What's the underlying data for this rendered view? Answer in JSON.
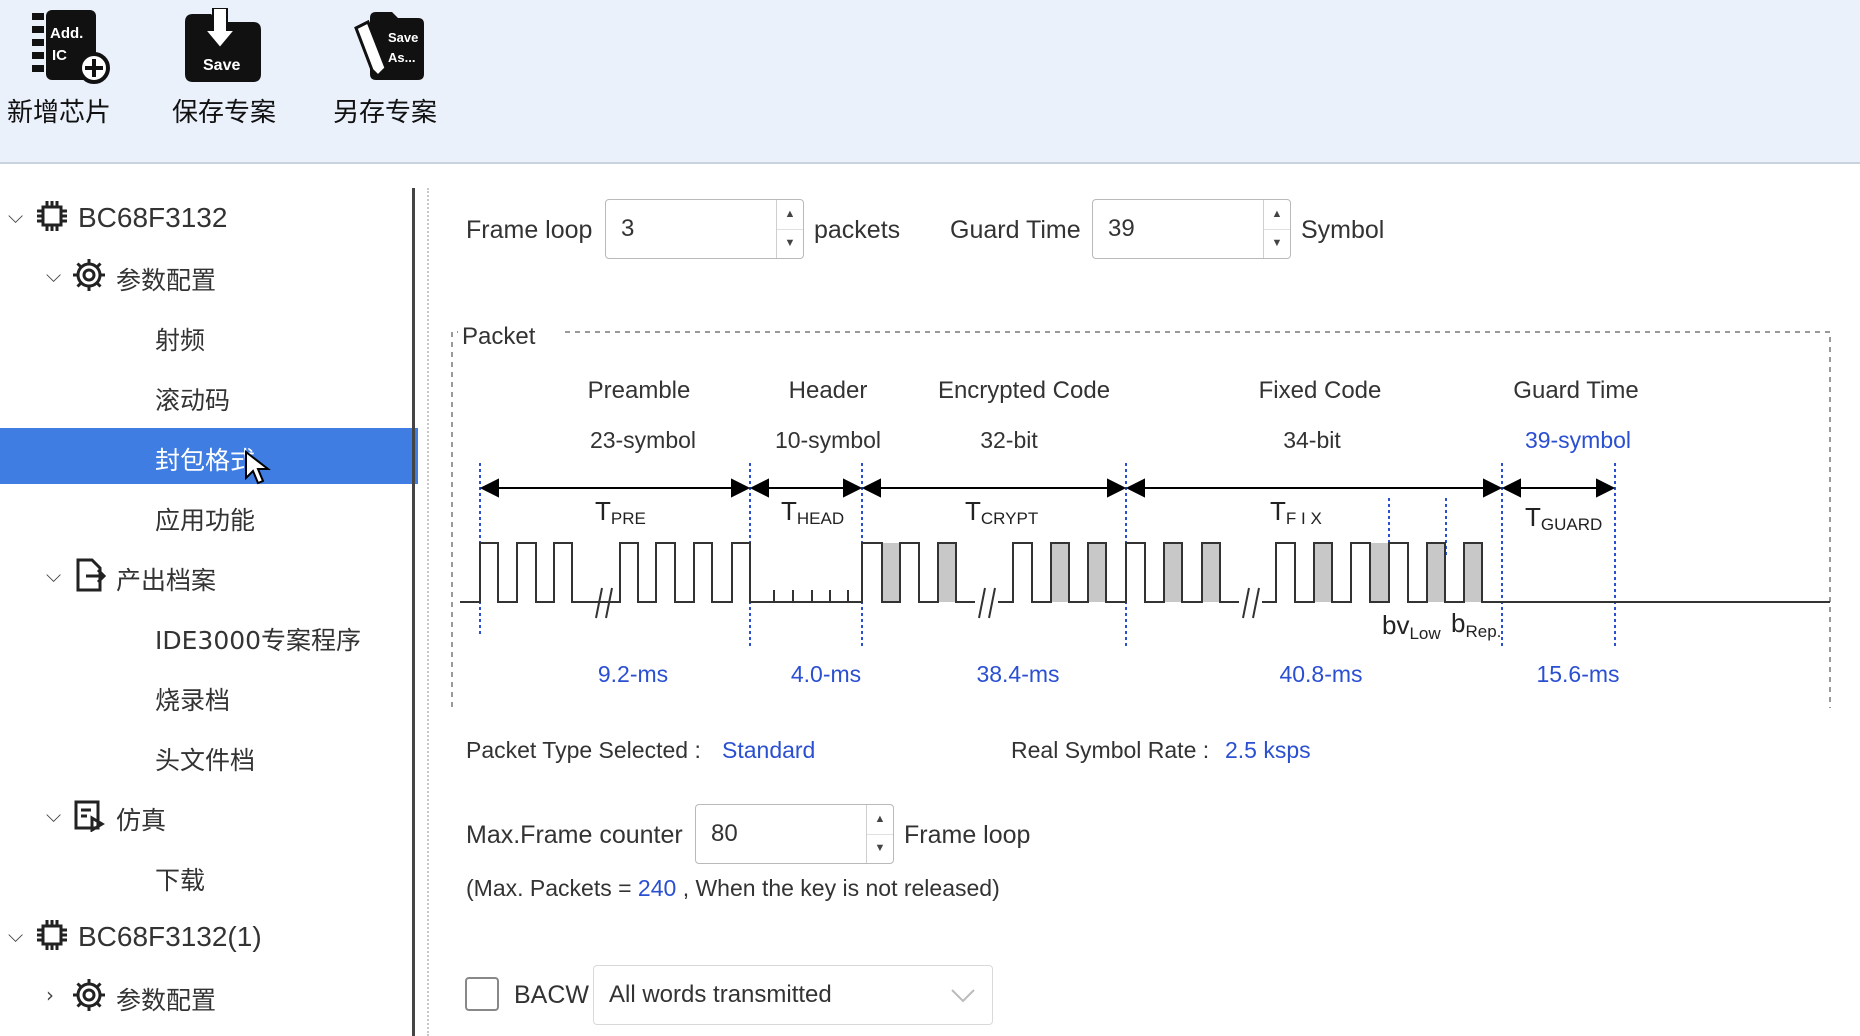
{
  "toolbar": {
    "buttons": [
      {
        "label": "新增芯片",
        "icon": "add-ic-icon",
        "icon_text_1": "Add.",
        "icon_text_2": "IC"
      },
      {
        "label": "保存专案",
        "icon": "save-icon",
        "icon_text": "Save"
      },
      {
        "label": "另存专案",
        "icon": "save-as-icon",
        "icon_text_1": "Save",
        "icon_text_2": "As..."
      }
    ]
  },
  "sidebar": {
    "items": [
      {
        "label": "BC68F3132",
        "icon": "chip-icon",
        "expand": "expanded"
      },
      {
        "label": "参数配置",
        "icon": "gear-icon",
        "expand": "expanded"
      },
      {
        "label": "射频"
      },
      {
        "label": "滚动码"
      },
      {
        "label": "封包格式",
        "selected": true
      },
      {
        "label": "应用功能"
      },
      {
        "label": "产出档案",
        "icon": "export-file-icon",
        "expand": "expanded"
      },
      {
        "label": "IDE3000专案程序"
      },
      {
        "label": "烧录档"
      },
      {
        "label": "头文件档"
      },
      {
        "label": "仿真",
        "icon": "emulator-icon",
        "expand": "expanded"
      },
      {
        "label": "下载"
      },
      {
        "label": "BC68F3132(1)",
        "icon": "chip-icon",
        "expand": "expanded"
      },
      {
        "label": "参数配置",
        "icon": "gear-icon",
        "expand": "collapsed"
      }
    ]
  },
  "frame_loop": {
    "label": "Frame loop",
    "value": "3",
    "unit": "packets"
  },
  "guard_time": {
    "label": "Guard Time",
    "value": "39",
    "unit": "Symbol"
  },
  "packet": {
    "title": "Packet",
    "segments": [
      {
        "name": "Preamble",
        "size": "23-symbol",
        "t_main": "T",
        "t_sub": "PRE",
        "duration": "9.2-ms"
      },
      {
        "name": "Header",
        "size": "10-symbol",
        "t_main": "T",
        "t_sub": "HEAD",
        "duration": "4.0-ms"
      },
      {
        "name": "Encrypted Code",
        "size": "32-bit",
        "t_main": "T",
        "t_sub": "CRYPT",
        "duration": "38.4-ms"
      },
      {
        "name": "Fixed Code",
        "size": "34-bit",
        "t_main": "T",
        "t_sub": "F I X",
        "duration": "40.8-ms"
      },
      {
        "name": "Guard Time",
        "size": "39-symbol",
        "t_main": "T",
        "t_sub": "GUARD",
        "duration": "15.6-ms"
      }
    ],
    "bv_main": "bv",
    "bv_sub": "Low",
    "brep_main": "b",
    "brep_sub": "Rep."
  },
  "packet_type": {
    "label": "Packet Type Selected :",
    "value": "Standard"
  },
  "symbol_rate": {
    "label": "Real Symbol Rate :",
    "value": "2.5 ksps"
  },
  "max_frame": {
    "label": "Max.Frame counter",
    "value": "80",
    "unit": "Frame loop"
  },
  "max_packets": {
    "prefix": "(Max. Packets =",
    "value": "240",
    "suffix": ", When the key is not released)"
  },
  "bacw": {
    "label": "BACW",
    "checked": false,
    "select_value": "All words transmitted"
  },
  "colors": {
    "accent": "#3f7de3",
    "blue_text": "#2a4fd1",
    "toolbar_bg": "#eaf1fb"
  }
}
